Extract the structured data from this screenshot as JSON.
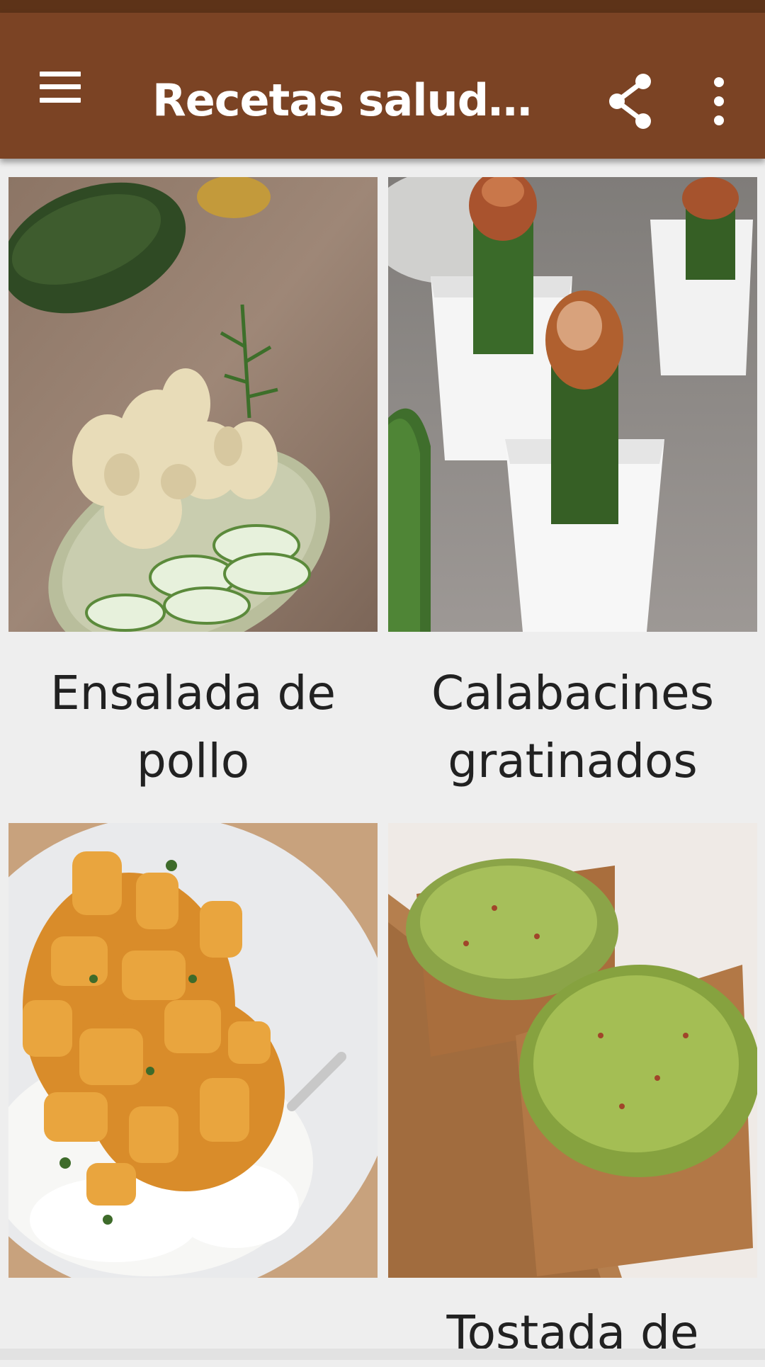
{
  "app_bar": {
    "title": "Recetas saludables…",
    "menu_icon": "menu-icon",
    "share_icon": "share-icon",
    "overflow_icon": "more-vert-icon",
    "color": "#7B4324",
    "status_bar_color": "#5D3318"
  },
  "recipes": [
    {
      "name": "Ensalada de pollo",
      "image": "chicken-salad-photo"
    },
    {
      "name": "Calabacines gratinados",
      "image": "stuffed-zucchini-photo"
    },
    {
      "name": "",
      "image": "chicken-curry-rice-photo"
    },
    {
      "name": "Tostada de",
      "image": "avocado-toast-photo"
    }
  ]
}
